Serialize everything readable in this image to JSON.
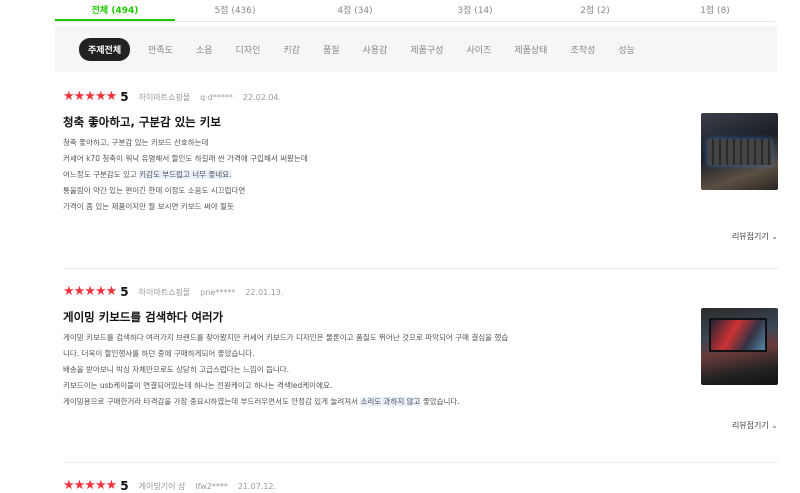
{
  "rating_tabs": [
    "전체 (494)",
    "5점 (436)",
    "4점 (34)",
    "3점 (14)",
    "2점 (2)",
    "1점 (8)"
  ],
  "filters": [
    "주제전체",
    "만족도",
    "소음",
    "디자인",
    "키감",
    "품질",
    "사용감",
    "제품구성",
    "사이즈",
    "제품상태",
    "조작성",
    "성능"
  ],
  "colors": {
    "accent_green": "#1ec800",
    "star_red": "#f5333f",
    "chip_dark": "#222222"
  },
  "reviews": [
    {
      "stars": "★★★★★",
      "score": "5",
      "store": "하이마트쇼핑몰",
      "user": "q·d*****",
      "date": "22.02.04.",
      "title": "청축 좋아하고, 구분감 있는 키보",
      "lines": [
        {
          "pre": "청축 좋아하고, 구분감 있는 키보드 선호하는데",
          "hl": "",
          "post": ""
        },
        {
          "pre": "커세어 k70 청축이 워낙 유명해서 할인도 하길래 싼 가격에 구입해서 써봤는데",
          "hl": "",
          "post": ""
        },
        {
          "pre": "어느정도 구분감도 있고 ",
          "hl": "키감도 부드럽고 너무 좋네요.",
          "post": ""
        },
        {
          "pre": "통울림이 약간 있는 편이긴 한데 이정도 소음도 시끄럽다면",
          "hl": "",
          "post": ""
        },
        {
          "pre": "가격이 좀 있는 제품이지만 뭘 보시면 키보드 써야 될듯",
          "hl": "",
          "post": ""
        }
      ],
      "thumb_icon": "keyboard-photo",
      "toggle": "리뷰접기기"
    },
    {
      "stars": "★★★★★",
      "score": "5",
      "store": "하이마트쇼핑몰",
      "user": "pne*****",
      "date": "22.01.13.",
      "title": "게이밍 키보드를 검색하다 여러가",
      "lines": [
        {
          "pre": "게이밍 키보드를 검색하다 여러가지 브랜드를 찾아봤지만 커세어 키보드가 디자인은 물론이고 품질도 뛰어난 것으로 파악되어 구매 결심을 했습",
          "hl": "",
          "post": ""
        },
        {
          "pre": "니다. 더욱이 할인행사를 하던 중에 구매하게되어 좋았습니다.",
          "hl": "",
          "post": ""
        },
        {
          "pre": "배송을 받아보니 박싱 자체만으로도 상당히 고급스럽다는 느낌이 듭니다.",
          "hl": "",
          "post": ""
        },
        {
          "pre": "키보드이는 usb케이블이 연결되어있는데 하나는 전원케이고 하나는 격색led케이에요.",
          "hl": "",
          "post": ""
        },
        {
          "pre": "게이밍용으로 구매한거라 타격감을 가장 중요시하였는데 부드러우면서도 안정감 있게 눌려져서 ",
          "hl": "소리도 과하지 않고",
          "post": " 좋았습니다."
        }
      ],
      "thumb_icon": "monitor-keyboard-photo",
      "toggle": "리뷰접기기"
    },
    {
      "stars": "★★★★★",
      "score": "5",
      "store": "게이밍기어 샵",
      "user": "lfw2****",
      "date": "21.07.12."
    }
  ]
}
